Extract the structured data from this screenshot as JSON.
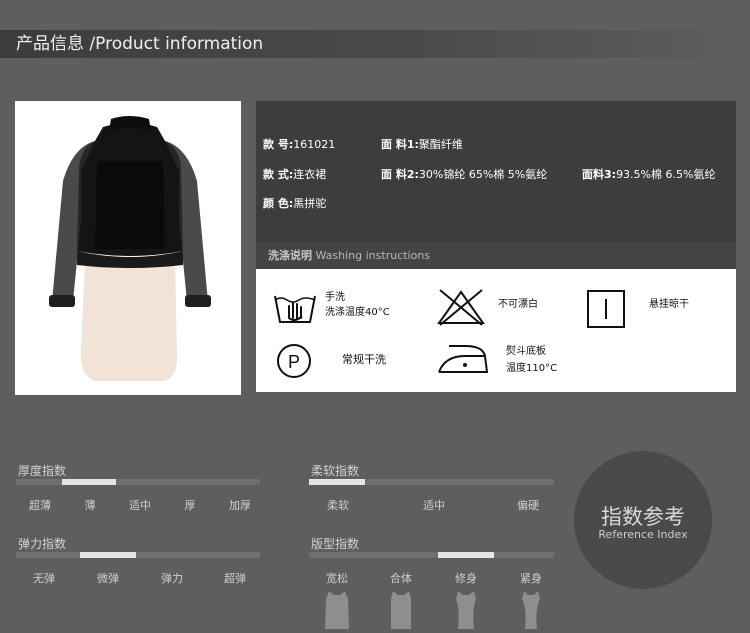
{
  "header": {
    "title": "产品信息 /Product information"
  },
  "product": {
    "style_no_label": "款 号:",
    "style_no": "161021",
    "style_label": "款 式:",
    "style": "连衣裙",
    "color_label": "颜 色:",
    "color": "黑拼驼",
    "fabric1_label": "面 料1:",
    "fabric1": "聚酯纤维",
    "fabric2_label": "面 料2:",
    "fabric2": "30%锦纶 65%棉 5%氨纶",
    "fabric3_label": "面料3:",
    "fabric3": "93.5%棉 6.5%氨纶"
  },
  "washing": {
    "title_zh": "洗涤说明",
    "title_en": "Washing instructions",
    "hand_wash_line1": "手洗",
    "hand_wash_line2": "洗涤温度40°C",
    "no_bleach": "不可漂白",
    "hang_dry": "悬挂晾干",
    "dry_clean": "常规干洗",
    "iron_line1": "熨斗底板",
    "iron_line2": "温度110°C"
  },
  "indices": {
    "thickness": {
      "label": "厚度指数",
      "ticks": [
        "超薄",
        "薄",
        "适中",
        "厚",
        "加厚"
      ],
      "selected": "薄"
    },
    "softness": {
      "label": "柔软指数",
      "ticks": [
        "柔软",
        "适中",
        "偏硬"
      ],
      "selected": "柔软"
    },
    "elasticity": {
      "label": "弹力指数",
      "ticks": [
        "无弹",
        "微弹",
        "弹力",
        "超弹"
      ],
      "selected": "微弹"
    },
    "fit": {
      "label": "版型指数",
      "ticks": [
        "宽松",
        "合体",
        "修身",
        "紧身"
      ],
      "selected": "修身"
    }
  },
  "reference": {
    "zh": "指数参考",
    "en": "Reference Index"
  },
  "colors": {
    "background": "#5e5e5e",
    "panel": "#3d3d3d",
    "slider_track": "#6f6f6f",
    "slider_mark": "#e6e6e6"
  }
}
